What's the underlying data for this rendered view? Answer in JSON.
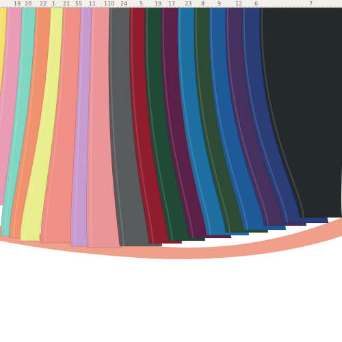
{
  "ruler": {
    "labels": [
      "19",
      "20",
      "22",
      "1",
      "21",
      "55",
      "11",
      "110",
      "24",
      "5",
      "19",
      "17",
      "23",
      "8",
      "9",
      "12",
      "6",
      "7"
    ]
  },
  "swatches": [
    {
      "name": "lemon",
      "color": "#f4e06a"
    },
    {
      "name": "pink",
      "color": "#ea9bb5"
    },
    {
      "name": "aqua",
      "color": "#7fd6c2"
    },
    {
      "name": "salmon",
      "color": "#f0926e"
    },
    {
      "name": "light-yellow",
      "color": "#e9ee8c"
    },
    {
      "name": "coral",
      "color": "#ef8f86"
    },
    {
      "name": "lilac",
      "color": "#c89bd0"
    },
    {
      "name": "rose",
      "color": "#ec9598"
    },
    {
      "name": "grey",
      "color": "#585a5c"
    },
    {
      "name": "crimson",
      "color": "#8f1d2c"
    },
    {
      "name": "forest-green",
      "color": "#1f4a35"
    },
    {
      "name": "plum",
      "color": "#5a2047"
    },
    {
      "name": "teal-blue",
      "color": "#1d6fa1"
    },
    {
      "name": "dark-green",
      "color": "#2c4a34"
    },
    {
      "name": "royal-blue",
      "color": "#1e5a98"
    },
    {
      "name": "purple",
      "color": "#45305e"
    },
    {
      "name": "navy",
      "color": "#2a3d76"
    },
    {
      "name": "charcoal",
      "color": "#24292b"
    }
  ],
  "background": {
    "fabric_base": "#efa08a",
    "backdrop": "#ffffff"
  }
}
